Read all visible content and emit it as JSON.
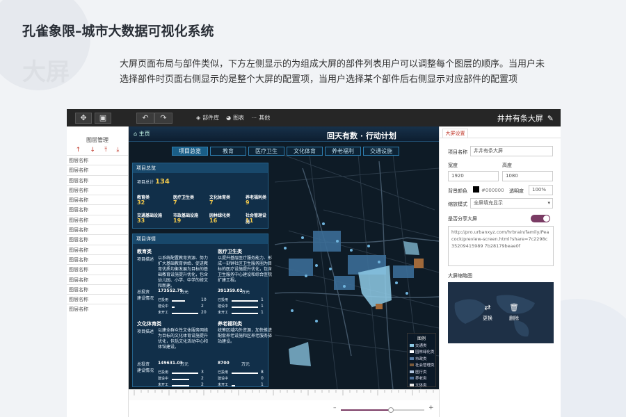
{
  "page": {
    "title": "孔雀象限–城市大数据可视化系统",
    "section": "大屏",
    "description": "大屏页面布局与部件类似，下方左侧显示的为组成大屏的部件列表用户可以调整每个图层的顺序。当用户未选择部件时页面右侧显示的是整个大屏的配置项，当用户选择某个部件后右侧显示对应部件的配置项"
  },
  "toolbar": {
    "component_lib": "部件库",
    "chart": "图表",
    "other": "其他",
    "screen_name": "井井有条大屏"
  },
  "layer_panel": {
    "title": "图层管理",
    "items": [
      "图层名称",
      "图层名称",
      "图层名称",
      "图层名称",
      "图层名称",
      "图层名称",
      "图层名称",
      "图层名称",
      "图层名称",
      "图层名称",
      "图层名称",
      "图层名称",
      "图层名称",
      "图层名称",
      "图层名称",
      "图层名称"
    ]
  },
  "canvas": {
    "home": "主页",
    "title": "回天有数 · 行动计划",
    "tabs": [
      "项目总览",
      "教育",
      "医疗卫生",
      "文化体育",
      "养老福利",
      "交通设施"
    ],
    "active_tab": 0
  },
  "overview": {
    "title": "项目总览",
    "total_label": "项目总计",
    "total": "134",
    "stats": [
      {
        "label": "教育类",
        "value": "32"
      },
      {
        "label": "医疗卫生类",
        "value": "7"
      },
      {
        "label": "文化体育类",
        "value": "7"
      },
      {
        "label": "养老福利类",
        "value": "9"
      },
      {
        "label": "交通基础设施",
        "value": "33"
      },
      {
        "label": "市政基础设施",
        "value": "19"
      },
      {
        "label": "园林绿化类",
        "value": "16"
      },
      {
        "label": "社会管理设施",
        "value": "11"
      }
    ]
  },
  "details": {
    "title": "项目详情",
    "desc_label": "项目描述",
    "invest_label": "总投资",
    "unit": "万元",
    "status_label": "建设情况",
    "status_names": [
      "已投用",
      "建设中",
      "未开工"
    ],
    "categories": [
      {
        "name": "教育类",
        "desc": "以系统配置教育资源、努力扩大基础教育供给、促进教育优质均衡发展为目标的基础教育设施提升优化，包含幼儿园、小学、中学的修文和新建。",
        "invest": "173552.79",
        "counts": [
          "10",
          "2",
          "20"
        ],
        "fills": [
          0.5,
          0.1,
          1.0
        ]
      },
      {
        "name": "医疗卫生类",
        "desc": "以提升基层医疗服务能力、形成一刻钟社区卫生服务圈为目标的医疗设施提升优化，包含卫生服务中心建设和综合医院扩建工程。",
        "invest": "391359.02",
        "counts": [
          "1",
          "1",
          "1"
        ],
        "fills": [
          1.0,
          1.0,
          1.0
        ]
      },
      {
        "name": "文化体育类",
        "desc": "以建全群众性文体服务网络为目标的文化体育设施提升优化，包括文化活动中心和体馆建设。",
        "invest": "149631.03",
        "counts": [
          "3",
          "2",
          "2"
        ],
        "fills": [
          1.0,
          0.67,
          0.67
        ]
      },
      {
        "name": "养老福利类",
        "desc": "统筹区域内外资源，加快推进配套养老设施和区养老服务驿站建设。",
        "invest": "8700",
        "counts": [
          "8",
          "0",
          "1"
        ],
        "fills": [
          1.0,
          0.0,
          0.12
        ]
      }
    ]
  },
  "legend": {
    "title": "图例",
    "items": [
      {
        "label": "交通类",
        "color": "#8ecae6"
      },
      {
        "label": "园林绿化类",
        "color": "#ffffff"
      },
      {
        "label": "市政类",
        "color": "#5a7fa8"
      },
      {
        "label": "社会管理类",
        "color": "#7a5a3a"
      },
      {
        "label": "医疗类",
        "color": "#b0c4de"
      },
      {
        "label": "养老类",
        "color": "#4b6f9a"
      },
      {
        "label": "文体类",
        "color": "#e8e8e8"
      },
      {
        "label": "教育类",
        "color": "#4aa3df"
      }
    ]
  },
  "zoom": {
    "minus": "–",
    "plus": "+",
    "level": 0.6
  },
  "settings": {
    "tab": "大屏设置",
    "name_label": "项目名称",
    "name_value": "井井有条大屏",
    "width_label": "宽度",
    "width_value": "1920",
    "height_label": "高度",
    "height_value": "1080",
    "bg_label": "背景颜色",
    "bg_value": "#000000",
    "opacity_label": "透明度",
    "opacity_value": "100%",
    "scale_label": "缩放模式",
    "scale_value": "全屏填充显示",
    "share_label": "是否分享大屏",
    "share_url": "http://pro.urbanxyz.com/hrbrain/family/Peacock/preview-screen.html?share=7c2298c35209415989 7b28179beae0f",
    "thumb_label": "大屏缩略图",
    "replace": "更换",
    "delete": "删除"
  },
  "colors": {
    "accent": "#c0392b",
    "toggle": "#7a3b64",
    "panel": "#12324e"
  }
}
